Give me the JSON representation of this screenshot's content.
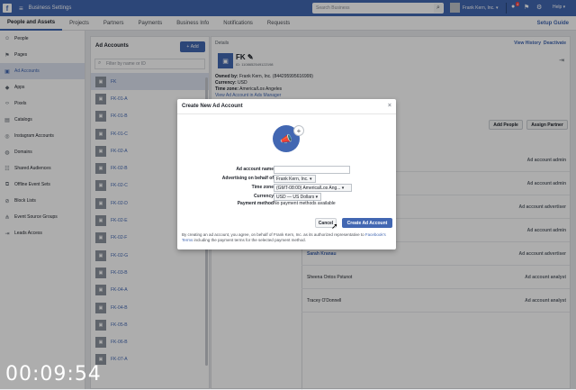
{
  "topbar": {
    "app_title": "Business Settings",
    "search_placeholder": "Search Business",
    "user_name": "Frank Kern, Inc.",
    "notif_count": "4",
    "help": "Help"
  },
  "nav": {
    "tabs": [
      "People and Assets",
      "Projects",
      "Partners",
      "Payments",
      "Business Info",
      "Notifications",
      "Requests"
    ],
    "setup_guide": "Setup Guide"
  },
  "sidebar": {
    "items": [
      "People",
      "Pages",
      "Ad Accounts",
      "Apps",
      "Pixels",
      "Catalogs",
      "Instagram Accounts",
      "Domains",
      "Shared Audiences",
      "Offline Event Sets",
      "Block Lists",
      "Event Source Groups",
      "Leads Access"
    ]
  },
  "ad_accounts": {
    "title": "Ad Accounts",
    "add_label": "Add",
    "filter_placeholder": "Filter by name or ID",
    "items": [
      "FK",
      "FK-01-A",
      "FK-01-B",
      "FK-01-C",
      "FK-02-A",
      "FK-02-B",
      "FK-02-C",
      "FK-02-D",
      "FK-02-E",
      "FK-02-F",
      "FK-02-G",
      "FK-03-B",
      "FK-04-A",
      "FK-04-B",
      "FK-05-B",
      "FK-06-B",
      "FK-07-A"
    ]
  },
  "details": {
    "label": "Details",
    "view_history": "View History",
    "separator": "|",
    "deactivate": "Deactivate",
    "name": "FK",
    "id": "ID: 1108652549122198",
    "owned_by_label": "Owned by:",
    "owned_by_value": "Frank Kern, Inc. (844295995616999)",
    "currency_label": "Currency:",
    "currency_value": "USD",
    "timezone_label": "Time zone:",
    "timezone_value": "America/Los Angeles",
    "view_link": "View Ad Account in Ads Manager",
    "add_people": "Add People",
    "assign_partner": "Assign Partner",
    "people": [
      {
        "name": "",
        "role": "Ad account admin",
        "link": false
      },
      {
        "name": "",
        "role": "Ad account admin",
        "link": false
      },
      {
        "name": "",
        "role": "Ad account advertiser",
        "link": false
      },
      {
        "name": "",
        "role": "Ad account admin",
        "link": false
      },
      {
        "name": "Sarah Kranau",
        "role": "Ad account advertiser",
        "link": true
      },
      {
        "name": "Sheena Ontos Pstunot",
        "role": "Ad account analyst",
        "link": false
      },
      {
        "name": "Tracey O'Donnell",
        "role": "Ad account analyst",
        "link": false
      }
    ]
  },
  "modal": {
    "title": "Create New Ad Account",
    "close": "×",
    "fields": {
      "name_label": "Ad account name",
      "behalf_label": "Advertising on behalf of",
      "behalf_value": "Frank Kern, Inc. ▾",
      "timezone_label": "Time zone",
      "timezone_value": "(GMT-08:00) America/Los Ang... ▾",
      "currency_label": "Currency",
      "currency_value": "USD — US Dollars ▾",
      "payment_label": "Payment method",
      "payment_value": "No payment methods available"
    },
    "disclaimer_pre": "By creating an ad account, you agree, on behalf of Frank Kern, Inc. as its authorized representative to",
    "disclaimer_link": "Facebook's Terms",
    "disclaimer_post": "including the payment terms for the selected payment method.",
    "cancel": "Cancel",
    "create": "Create Ad Account"
  },
  "timer": "00:09:54"
}
